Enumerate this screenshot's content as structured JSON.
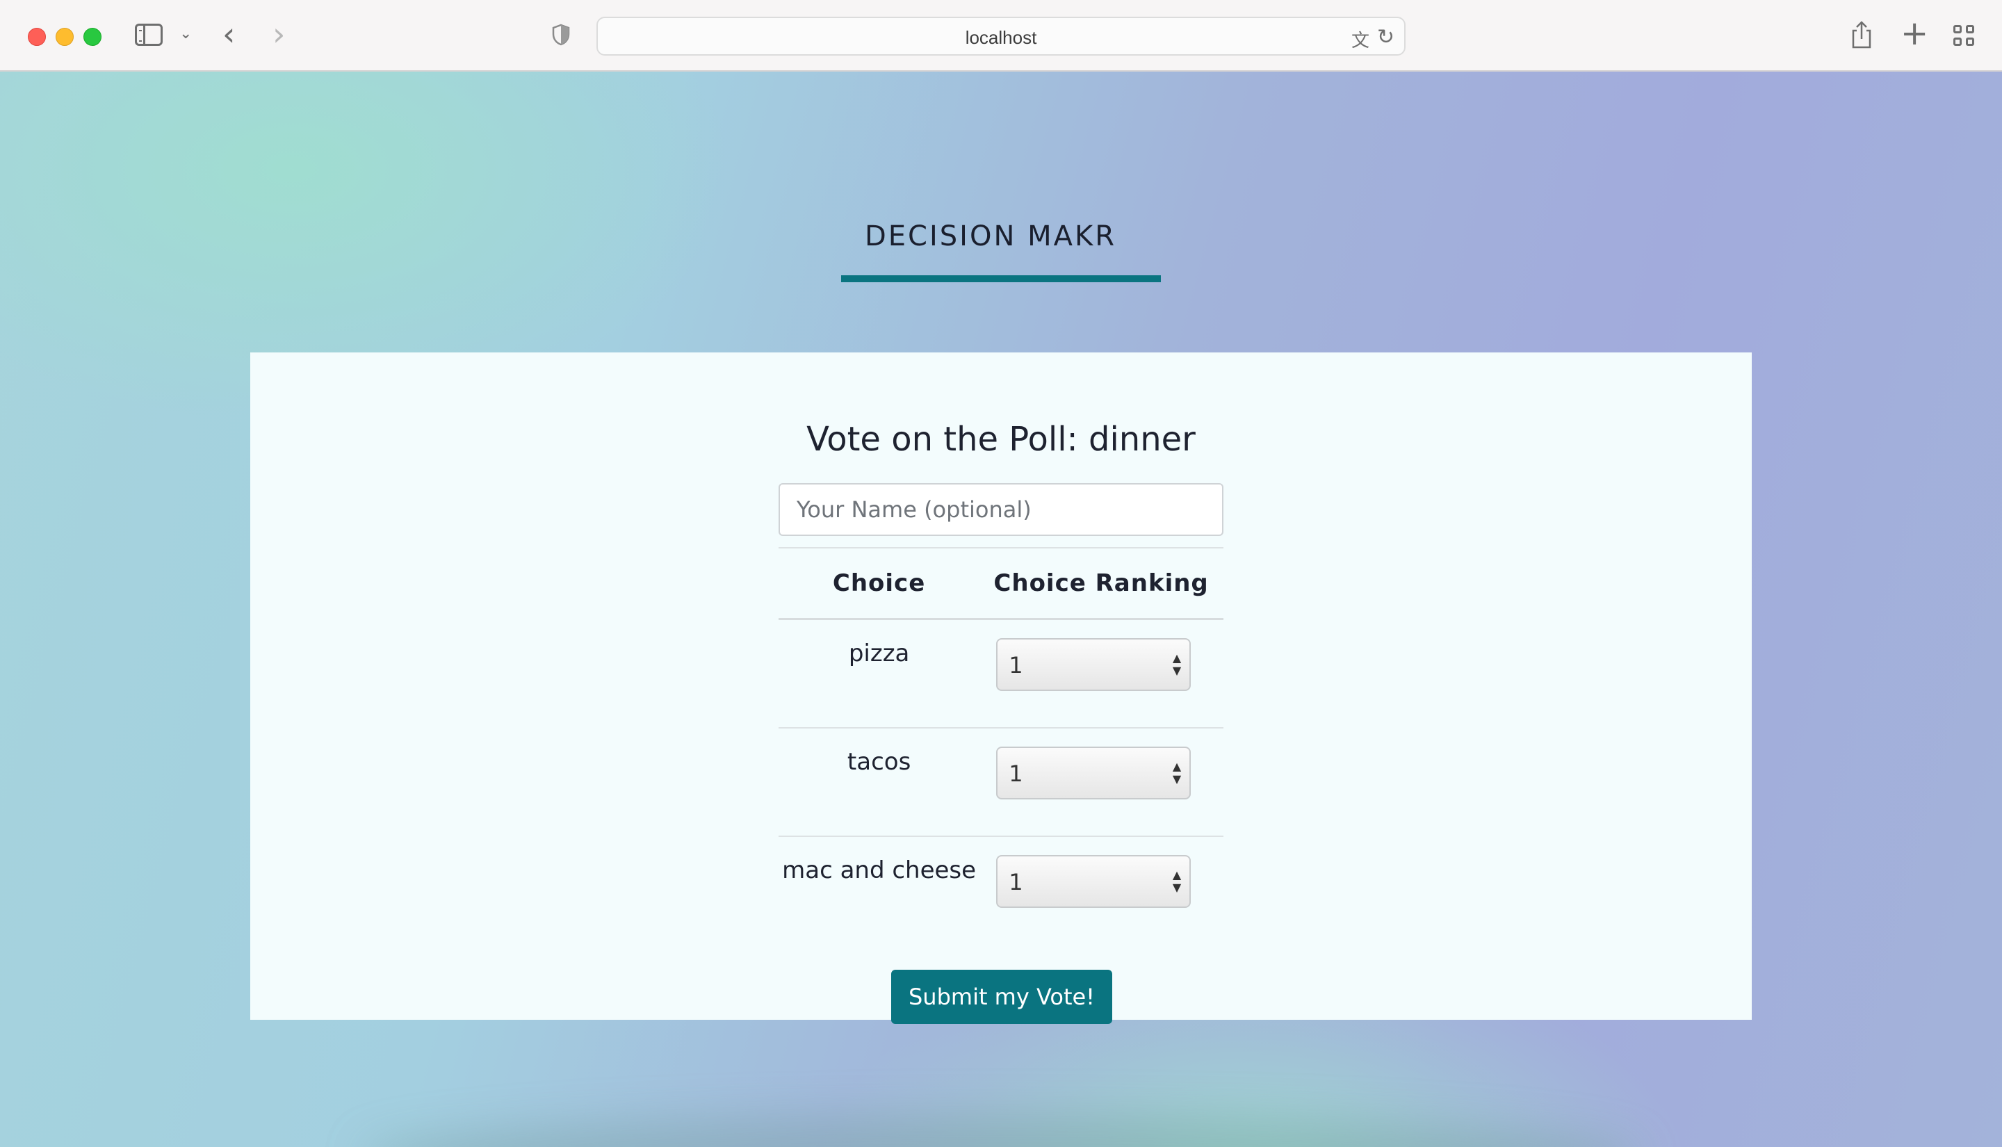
{
  "browser": {
    "url": "localhost"
  },
  "page": {
    "brand": "DECISION MAKR",
    "poll_title": "Vote on the Poll: dinner",
    "name_placeholder": "Your Name (optional)",
    "table": {
      "headers": [
        "Choice",
        "Choice Ranking"
      ],
      "rows": [
        {
          "choice": "pizza",
          "rank": "1"
        },
        {
          "choice": "tacos",
          "rank": "1"
        },
        {
          "choice": "mac and cheese",
          "rank": "1"
        }
      ]
    },
    "submit_label": "Submit my Vote!"
  },
  "colors": {
    "accent": "#0a7480",
    "card_bg": "#f3fcfd"
  }
}
